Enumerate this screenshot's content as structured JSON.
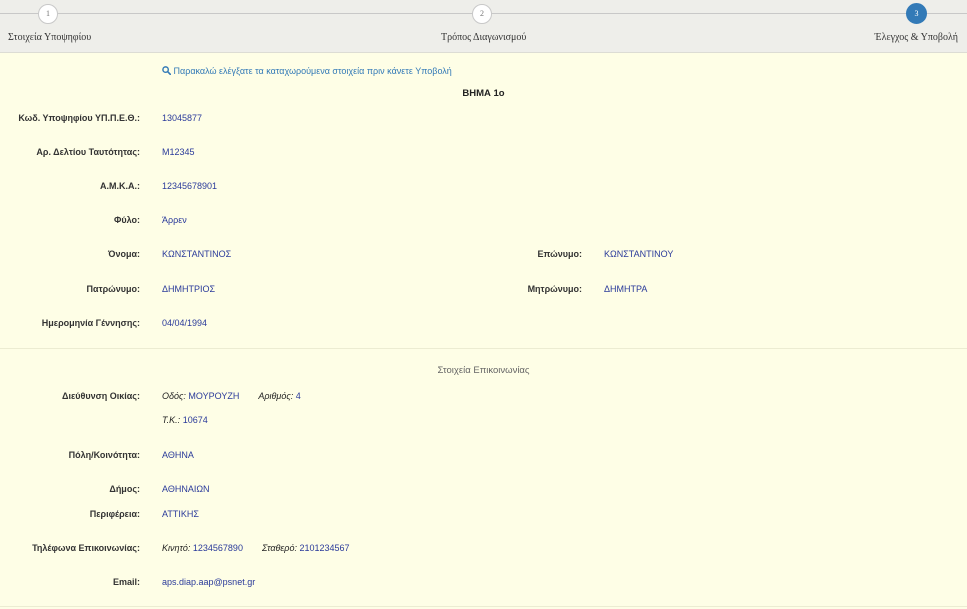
{
  "wizard": {
    "steps": [
      {
        "number": "1",
        "label": "Στοιχεία Υποψηφίου"
      },
      {
        "number": "2",
        "label": "Τρόπος Διαγωνισμού"
      },
      {
        "number": "3",
        "label": "Έλεγχος & Υποβολή"
      }
    ],
    "active_step": 3
  },
  "notice": "Παρακαλώ ελέγξατε τα καταχωρούμενα στοιχεία πριν κάνετε Υποβολή",
  "step_title": "ΒΗΜΑ 1ο",
  "fields": {
    "candidate_code": {
      "label": "Κωδ. Υποψηφίου ΥΠ.Π.Ε.Θ.:",
      "value": "13045877"
    },
    "id_card": {
      "label": "Αρ. Δελτίου Ταυτότητας:",
      "value": "M12345"
    },
    "amka": {
      "label": "Α.Μ.Κ.Α.:",
      "value": "12345678901"
    },
    "gender": {
      "label": "Φύλο:",
      "value": "Άρρεν"
    },
    "first_name": {
      "label": "Όνομα:",
      "value": "ΚΩΝΣΤΑΝΤΙΝΟΣ"
    },
    "last_name": {
      "label": "Επώνυμο:",
      "value": "ΚΩΝΣΤΑΝΤΙΝΟΥ"
    },
    "father_name": {
      "label": "Πατρώνυμο:",
      "value": "ΔΗΜΗΤΡΙΟΣ"
    },
    "mother_name": {
      "label": "Μητρώνυμο:",
      "value": "ΔΗΜΗΤΡΑ"
    },
    "birth_date": {
      "label": "Ημερομηνία Γέννησης:",
      "value": "04/04/1994"
    }
  },
  "contact": {
    "section_title": "Στοιχεία Επικοινωνίας",
    "address": {
      "label": "Διεύθυνση Οικίας:",
      "street_label": "Οδός:",
      "street": "ΜΟΥΡΟΥΖΗ",
      "number_label": "Αριθμός:",
      "number": "4",
      "postal_label": "Τ.Κ.:",
      "postal": "10674"
    },
    "city": {
      "label": "Πόλη/Κοινότητα:",
      "value": "ΑΘΗΝΑ"
    },
    "municipality": {
      "label": "Δήμος:",
      "value": "ΑΘΗΝΑΙΩΝ"
    },
    "region": {
      "label": "Περιφέρεια:",
      "value": "ΑΤΤΙΚΗΣ"
    },
    "phones": {
      "label": "Τηλέφωνα Επικοινωνίας:",
      "mobile_label": "Κινητό:",
      "mobile": "1234567890",
      "landline_label": "Σταθερό:",
      "landline": "2101234567"
    },
    "email": {
      "label": "Email:",
      "value": "aps.diap.aap@psnet.gr"
    }
  },
  "colors": {
    "background": "#fefee6",
    "accent": "#337ab7",
    "value_text": "#2a3a9a"
  }
}
